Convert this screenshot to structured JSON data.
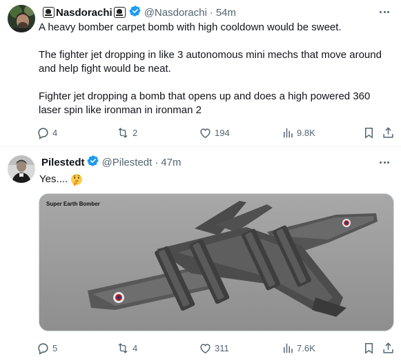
{
  "tweets": [
    {
      "display_name": "Nasdorachi",
      "handle": "@Nasdorachi",
      "time": "54m",
      "paragraphs": [
        "A heavy bomber carpet bomb with high cooldown would be sweet.",
        "The fighter jet dropping in like 3 autonomous mini mechs that move around and help fight would be neat.",
        "Fighter jet dropping a bomb that opens up and does a high powered 360 laser spin like ironman in ironman 2"
      ],
      "replies": "4",
      "reposts": "2",
      "likes": "194",
      "views": "9.8K"
    },
    {
      "display_name": "Pilestedt",
      "handle": "@Pilestedt",
      "time": "47m",
      "text": "Yes....",
      "emoji": "thinking-face-emoji",
      "media_caption": "Super Earth Bomber",
      "replies": "5",
      "reposts": "4",
      "likes": "311",
      "views": "7.6K"
    }
  ],
  "separator": "·",
  "colors": {
    "verified": "#1d9bf0",
    "text": "#0f1419",
    "muted": "#536471",
    "border": "#eff3f4"
  },
  "icons": [
    "skull-crossbones-icon",
    "verified-badge-icon",
    "more-icon",
    "reply-icon",
    "repost-icon",
    "like-icon",
    "views-icon",
    "bookmark-icon",
    "share-icon"
  ]
}
